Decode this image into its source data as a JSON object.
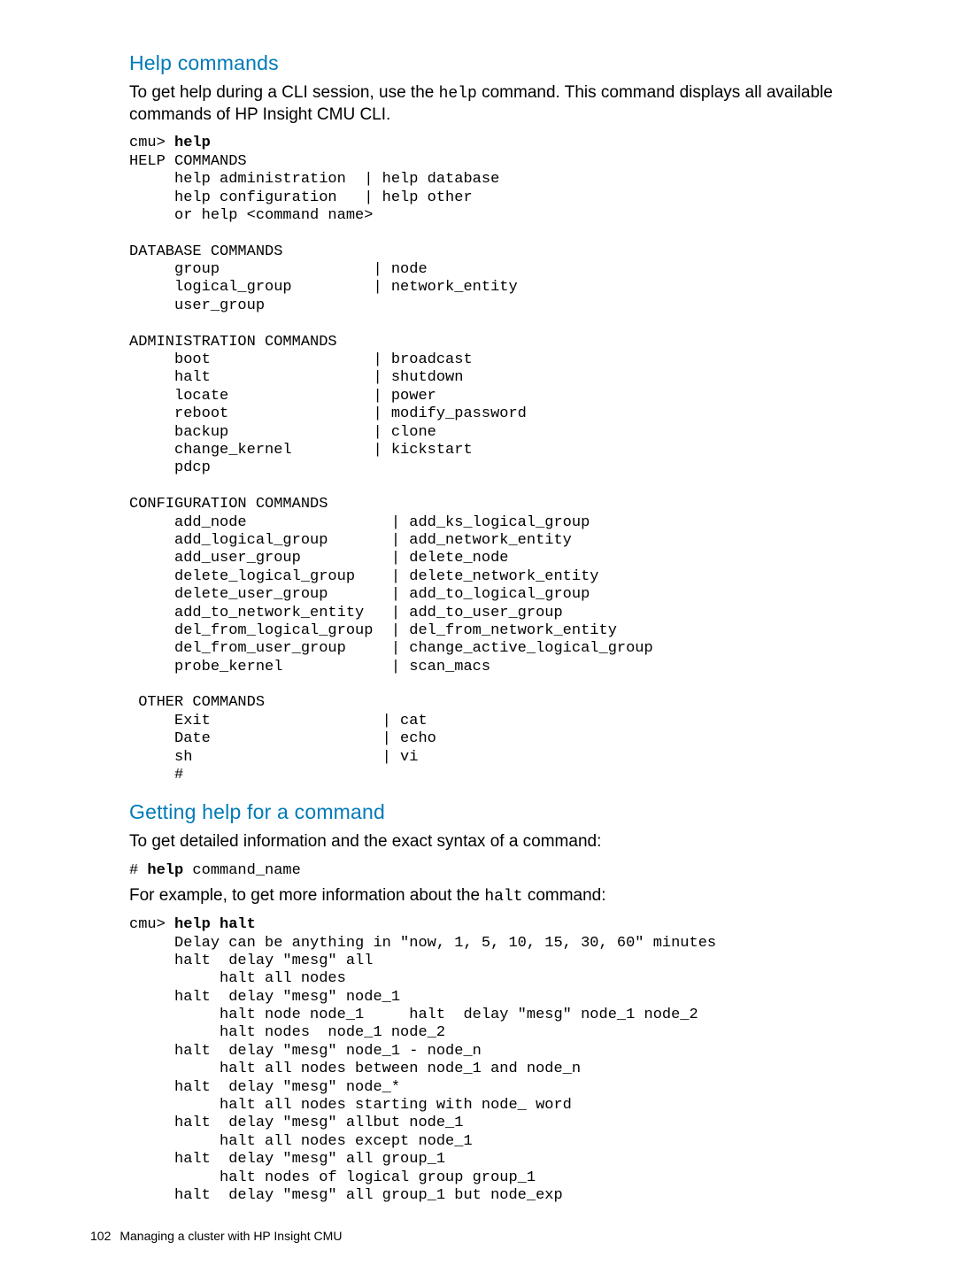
{
  "sections": {
    "help_commands": {
      "title": "Help commands",
      "intro_pre": "To get help during a CLI session, use the ",
      "intro_code": "help",
      "intro_post": " command. This command displays all available commands of HP Insight CMU CLI.",
      "prompt": "cmu> ",
      "cmd": "help",
      "output": "HELP COMMANDS\n     help administration  | help database\n     help configuration   | help other\n     or help <command name>\n\nDATABASE COMMANDS\n     group                 | node\n     logical_group         | network_entity\n     user_group\n\nADMINISTRATION COMMANDS\n     boot                  | broadcast\n     halt                  | shutdown\n     locate                | power\n     reboot                | modify_password\n     backup                | clone\n     change_kernel         | kickstart\n     pdcp\n\nCONFIGURATION COMMANDS\n     add_node                | add_ks_logical_group\n     add_logical_group       | add_network_entity\n     add_user_group          | delete_node\n     delete_logical_group    | delete_network_entity\n     delete_user_group       | add_to_logical_group\n     add_to_network_entity   | add_to_user_group\n     del_from_logical_group  | del_from_network_entity\n     del_from_user_group     | change_active_logical_group\n     probe_kernel            | scan_macs\n\n OTHER COMMANDS\n     Exit                   | cat\n     Date                   | echo\n     sh                     | vi\n     #"
    },
    "getting_help": {
      "title": "Getting help for a command",
      "intro": "To get detailed information and the exact syntax of a command:",
      "usage_prefix": "# ",
      "usage_cmd": "help",
      "usage_arg": " command_name",
      "example_pre": "For example, to get more information about the ",
      "example_code": "halt",
      "example_post": " command:",
      "prompt": "cmu> ",
      "cmd": "help halt",
      "output": "     Delay can be anything in \"now, 1, 5, 10, 15, 30, 60\" minutes\n     halt  delay \"mesg\" all\n          halt all nodes\n     halt  delay \"mesg\" node_1\n          halt node node_1     halt  delay \"mesg\" node_1 node_2\n          halt nodes  node_1 node_2\n     halt  delay \"mesg\" node_1 - node_n\n          halt all nodes between node_1 and node_n\n     halt  delay \"mesg\" node_*\n          halt all nodes starting with node_ word\n     halt  delay \"mesg\" allbut node_1\n          halt all nodes except node_1\n     halt  delay \"mesg\" all group_1\n          halt nodes of logical group group_1\n     halt  delay \"mesg\" all group_1 but node_exp"
    }
  },
  "footer": {
    "page_number": "102",
    "chapter": "Managing a cluster with HP Insight CMU"
  }
}
